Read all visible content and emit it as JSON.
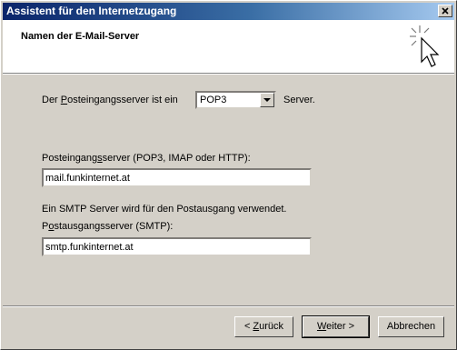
{
  "window": {
    "title": "Assistent für den Internetzugang",
    "close_glyph": "×"
  },
  "header": {
    "title": "Namen der E-Mail-Server"
  },
  "incoming_type": {
    "label_pre": "Der ",
    "label_underlined": "P",
    "label_post": "osteingangsserver ist ein",
    "selected": "POP3",
    "suffix": "Server."
  },
  "incoming_server": {
    "label_pre": "Posteingang",
    "label_underlined": "s",
    "label_post": "server (POP3, IMAP oder HTTP):",
    "value": "mail.funkinternet.at"
  },
  "smtp_note": "Ein SMTP Server wird für den Postausgang verwendet.",
  "outgoing_server": {
    "label_pre": "P",
    "label_underlined": "o",
    "label_post": "stausgangsserver (SMTP):",
    "value": "smtp.funkinternet.at"
  },
  "buttons": {
    "back": {
      "pre": "< ",
      "underlined": "Z",
      "post": "urück"
    },
    "next": {
      "underlined": "W",
      "post": "eiter >"
    },
    "cancel": "Abbrechen"
  }
}
